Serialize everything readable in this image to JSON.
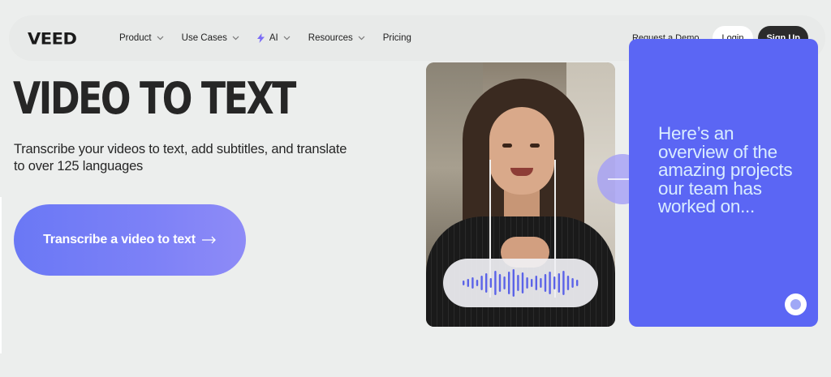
{
  "nav": {
    "logo": "VEED",
    "items": [
      {
        "label": "Product",
        "has_dropdown": true,
        "icon": ""
      },
      {
        "label": "Use Cases",
        "has_dropdown": true,
        "icon": ""
      },
      {
        "label": "AI",
        "has_dropdown": true,
        "icon": "lightning-icon"
      },
      {
        "label": "Resources",
        "has_dropdown": true,
        "icon": ""
      },
      {
        "label": "Pricing",
        "has_dropdown": false,
        "icon": ""
      }
    ],
    "request_demo": "Request a Demo",
    "login": "Login",
    "signup": "Sign Up"
  },
  "hero": {
    "title": "VIDEO TO TEXT",
    "subtitle": "Transcribe your videos to text, add subtitles, and translate to over 125 languages",
    "cta": "Transcribe a video to text"
  },
  "cards": {
    "video_card_icon": "audio-waveform-icon",
    "arrow_icon": "arrow-right-icon",
    "purple_text": "Here’s an overview of the amazing projects our team has worked on...",
    "loading_icon": "loading-indicator-icon"
  },
  "colors": {
    "accent_purple": "#5b66f4",
    "cta_start": "#6a78f5",
    "cta_end": "#8e8bf7",
    "dark_button": "#2b2b2b",
    "background": "#eceeed",
    "waveform": "#5b63e8"
  }
}
